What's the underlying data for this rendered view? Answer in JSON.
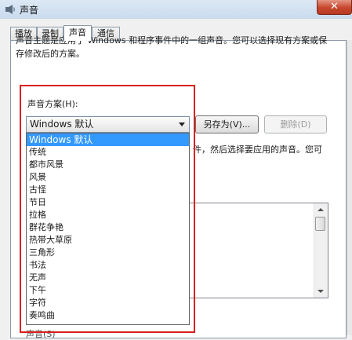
{
  "window": {
    "title": "声音",
    "close_glyph": "✕"
  },
  "tabs": [
    {
      "label": "播放"
    },
    {
      "label": "录制"
    },
    {
      "label": "声音"
    },
    {
      "label": "通信"
    }
  ],
  "description": "声音主题是应用于 Windows 和程序事件中的一组声音。您可以选择现有方案或保存修改后的方案。",
  "scheme": {
    "label": "声音方案(H):",
    "selected": "Windows 默认",
    "save_as_label": "另存为(V)...",
    "delete_label": "删除(D)",
    "options": [
      "Windows 默认",
      "传统",
      "都市风景",
      "风景",
      "古怪",
      "节日",
      "拉格",
      "群花争艳",
      "热带大草原",
      "三角形",
      "书法",
      "无声",
      "下午",
      "字符",
      "奏鸣曲"
    ]
  },
  "events_hint_partial": "件，然后选择要应用的声音。您可",
  "bottom_label_partial": "声音(S)",
  "colors": {
    "highlight": "#3399ff",
    "annotation_frame": "#d9201c"
  }
}
